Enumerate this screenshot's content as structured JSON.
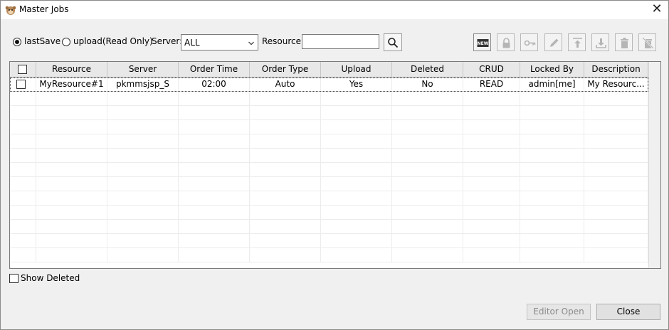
{
  "window": {
    "title": "Master Jobs",
    "close_glyph": "✕"
  },
  "filters": {
    "mode_options": [
      {
        "label": "lastSave",
        "selected": true
      },
      {
        "label": "upload(Read Only)",
        "selected": false
      }
    ],
    "server_label": "Server:",
    "server_value": "ALL",
    "resource_label": "Resource:",
    "resource_value": ""
  },
  "toolbar_icons": [
    "new-icon",
    "lock-icon",
    "key-icon",
    "pencil-icon",
    "upload-icon",
    "download-icon",
    "trash-icon",
    "delete-all-icon"
  ],
  "toolbar_badge_text": "NEW",
  "table": {
    "columns": [
      "Resource",
      "Server",
      "Order Time",
      "Order Type",
      "Upload",
      "Deleted",
      "CRUD",
      "Locked By",
      "Description"
    ],
    "rows": [
      {
        "checked": false,
        "cells": [
          "MyResource#1",
          "pkmmsjsp_S",
          "02:00",
          "Auto",
          "Yes",
          "No",
          "READ",
          "admin[me]",
          "My Resourc..."
        ]
      }
    ],
    "empty_rows": 12
  },
  "show_deleted": {
    "label": "Show Deleted",
    "checked": false
  },
  "buttons": {
    "editor_open": "Editor Open",
    "close": "Close"
  }
}
